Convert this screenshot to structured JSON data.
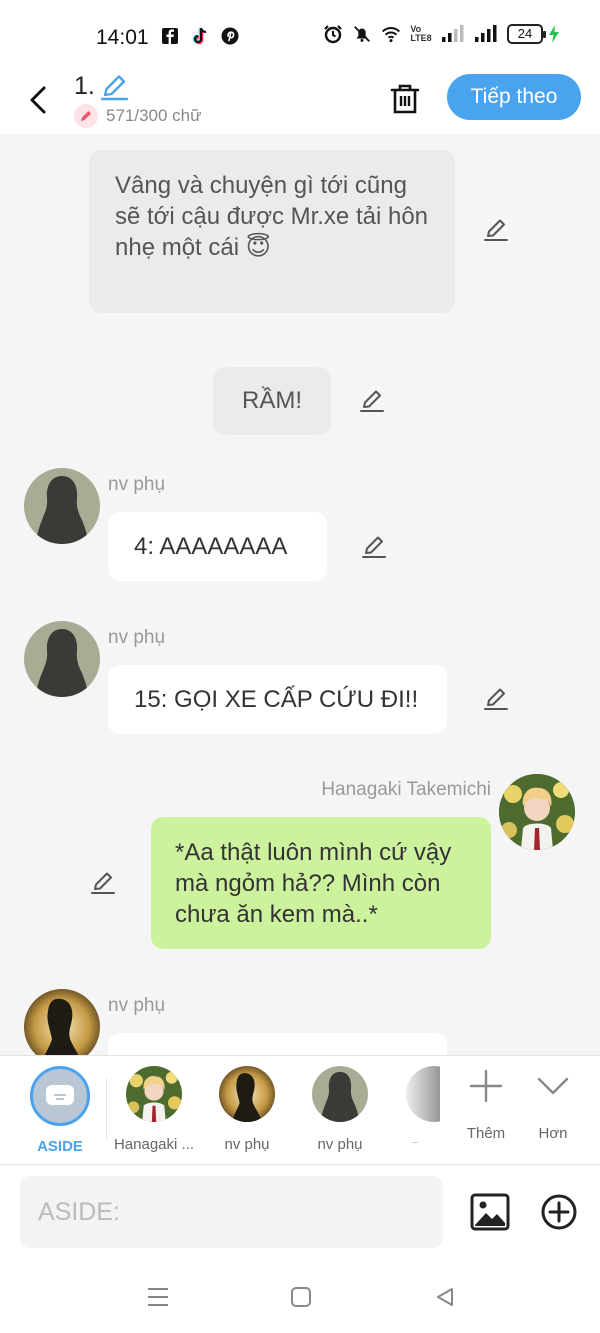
{
  "status_bar": {
    "time": "14:01",
    "network": "Vo\nLTE8",
    "battery": "24"
  },
  "header": {
    "title": "1.",
    "word_count": "571/300 chữ",
    "next_label": "Tiếp theo"
  },
  "messages": [
    {
      "type": "narration",
      "text": "Vâng và chuyện gì tới cũng sẽ tới cậu được Mr.xe tải hôn nhẹ một cái 😇"
    },
    {
      "type": "narration",
      "text": "RẦM!"
    },
    {
      "type": "character",
      "name": "nv phụ",
      "text": "4: AAAAAAAA"
    },
    {
      "type": "character",
      "name": "nv phụ",
      "text": "15: GỌI XE CẤP CỨU ĐI!!"
    },
    {
      "type": "self",
      "name": "Hanagaki Takemichi",
      "text": "*Aa thật luôn mình cứ vậy mà ngỏm hả?? Mình còn chưa ăn kem mà..*"
    },
    {
      "type": "character",
      "name": "nv phụ",
      "text": ""
    }
  ],
  "character_bar": {
    "items": [
      {
        "label": "ASIDE"
      },
      {
        "label": "Hanagaki ..."
      },
      {
        "label": "nv phụ"
      },
      {
        "label": "nv phụ"
      },
      {
        "label": "..."
      }
    ],
    "more_label": "Thêm",
    "expand_label": "Hơn"
  },
  "input": {
    "placeholder": "ASIDE:"
  },
  "colors": {
    "accent": "#4aa3ef",
    "self_bubble": "#cdf29e",
    "narration_bubble": "#ebebeb"
  }
}
